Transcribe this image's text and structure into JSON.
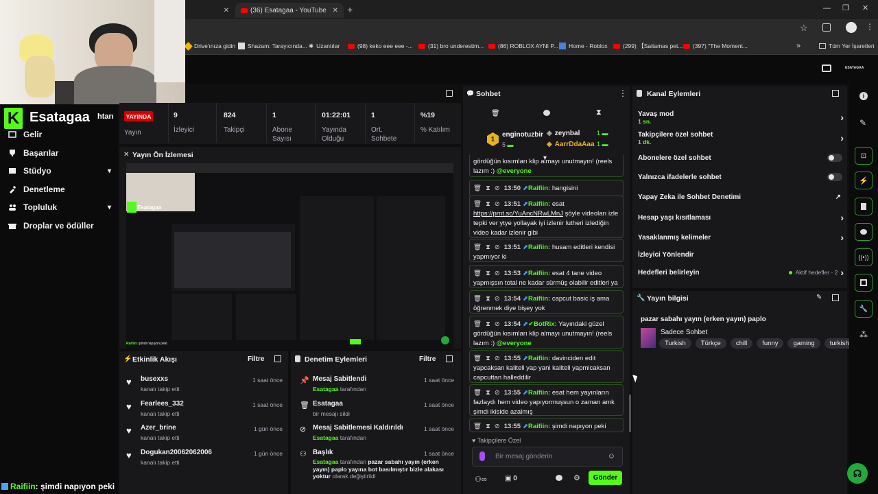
{
  "browser": {
    "tab_active": "(36) Esatagaa - YouTube",
    "bookmarks": [
      "Drive'ınıza gidin",
      "Shazam: Tarayıcında...",
      "Uzantılar",
      "(98) keko eee eee -...",
      "(31) bro underestim...",
      "(86) ROBLOX AYNI P...",
      "Home - Roblox",
      "(299) 【Saitamas pet...",
      "(397) \"The Moment...",
      "Tüm Yer İşaretleri"
    ],
    "more": "»"
  },
  "brand": {
    "logo_letter": "K",
    "channel": "Esatagaa",
    "cutoff": "htarı"
  },
  "header": {
    "user_short": "ESATAGAA"
  },
  "sidebar": {
    "items": [
      {
        "label": "Gelir",
        "icon": "money-icon"
      },
      {
        "label": "Başarılar",
        "icon": "trophy-icon"
      },
      {
        "label": "Stüdyo",
        "icon": "studio-icon",
        "expand": true
      },
      {
        "label": "Denetleme",
        "icon": "wrench-icon"
      },
      {
        "label": "Topluluk",
        "icon": "people-icon",
        "expand": true
      },
      {
        "label": "Droplar ve ödüller",
        "icon": "gift-icon"
      }
    ]
  },
  "stats": {
    "live_badge": "YAYINDA",
    "live_label": "Yayın",
    "items": [
      {
        "value": "9",
        "label": "İzleyici"
      },
      {
        "value": "824",
        "label": "Takipçi"
      },
      {
        "value": "1",
        "label": "Abone Sayısı"
      },
      {
        "value": "01:22:01",
        "label": "Yayında Olduğu"
      },
      {
        "value": "1",
        "label": "Ort. Sohbete"
      },
      {
        "value": "%19",
        "label": "% Katılım"
      }
    ]
  },
  "preview": {
    "title": "Yayın Ön İzlemesi",
    "mini_chat_user": "Raifiin",
    "mini_chat_text": ": şimdi napıyon peki"
  },
  "activity": {
    "title": "Etkinlik Akışı",
    "filter": "Filtre",
    "items": [
      {
        "name": "busexxs",
        "sub": "kanalı takip etti",
        "time": "1 saat önce"
      },
      {
        "name": "Fearlees_332",
        "sub": "kanalı takip etti",
        "time": "1 saat önce"
      },
      {
        "name": "Azer_brine",
        "sub": "kanalı takip etti",
        "time": "1 gün önce"
      },
      {
        "name": "Dogukan20062062006",
        "sub": "kanalı takip etti",
        "time": "1 gün önce"
      }
    ]
  },
  "moderation": {
    "title": "Denetim Eylemleri",
    "filter": "Filtre",
    "items": [
      {
        "title": "Mesaj Sabitlendi",
        "by": "Esatagaa",
        "suffix": " tarafından",
        "time": "1 saat önce",
        "icon": "pin-icon"
      },
      {
        "title": "Esatagaa",
        "by": "",
        "suffix": "bir mesajı sildi",
        "time": "1 saat önce",
        "icon": "trash-icon"
      },
      {
        "title": "Mesaj Sabitlemesi Kaldırıldı",
        "by": "Esatagaa",
        "suffix": " tarafından",
        "time": "1 saat önce",
        "icon": "unpin-icon"
      },
      {
        "title": "Başlık",
        "by": "Esatagaa",
        "suffix": " tarafından ",
        "bold": "pazar sabahı yayın (erken yayın) paplo yayına bot basılmıştır bizle alakası yoktur",
        "tail": " olarak değiştirildi",
        "time": "1 saat önce",
        "icon": "title-icon"
      }
    ]
  },
  "chat": {
    "title": "Sohbet",
    "leader": {
      "rank": "1",
      "name": "enginotuzbir",
      "count": "5"
    },
    "gifters": [
      {
        "name": "zeynbal",
        "count": "1"
      },
      {
        "name": "AarrDdaAaa",
        "count": "1"
      }
    ],
    "top_fragment": "gördüğün kısımları klip almayı unutmayın! (reels lazım :)",
    "top_mention": "@everyone",
    "messages": [
      {
        "time": "13:50",
        "user": "Raifiin",
        "text": "hangisini"
      },
      {
        "time": "13:51",
        "user": "Raifiin",
        "text": "esat",
        "link": "https://prnt.sc/YuAncNRwLMnJ",
        "rest": " şöyle videoları izle tepki ver ytye yollayak iyi izlenir lutheri izlediğin video kadar izlenir gibi"
      },
      {
        "time": "13:51",
        "user": "Raifiin",
        "text": "husam editleri kendisi yapmıyor ki"
      },
      {
        "time": "13:53",
        "user": "Raifiin",
        "text": "esat 4 tane video yapmışsın total ne kadar sürmüş olabilir editleri ya"
      },
      {
        "time": "13:54",
        "user": "Raifiin",
        "text": "capcut basic iş ama öğrenmek diye bişey yok"
      },
      {
        "time": "13:54",
        "user": "BotRix",
        "text": "Yayındaki güzel gördüğün kısımları klip almayı unutmayın! (reels lazım :)",
        "mention": "@everyone"
      },
      {
        "time": "13:55",
        "user": "Raifiin",
        "text": "davinciden edit yapcaksan kaliteli yap yani kaliteli yapmicaksan capcuttan halleddilir"
      },
      {
        "time": "13:55",
        "user": "Raifiin",
        "text": "esat hem yayınların fazlaydı hem video yapıyormuşsun o zaman amk şimdi ikiside azalmış"
      },
      {
        "time": "13:55",
        "user": "Raifiin",
        "text": "şimdi napıyon peki"
      }
    ],
    "follower_only": "Takipçilere Özel",
    "input_placeholder": "Bir mesaj gönderin",
    "count": "0",
    "send": "Gönder"
  },
  "channel_actions": {
    "title": "Kanal Eylemleri",
    "slow_mode": "Yavaş mod",
    "slow_mode_val": "1 sn.",
    "followers_only": "Takipçilere özel sohbet",
    "followers_only_val": "1 dk.",
    "subscribers_only": "Abonelere özel sohbet",
    "emote_only": "Yalnızca ifadelerle sohbet",
    "ai_moderation": "Yapay Zeka ile Sohbet Denetimi",
    "account_age": "Hesap yaşı kısıtlaması",
    "banned_words": "Yasaklanmış kelimeler",
    "redirect": "İzleyici Yönlendir",
    "goals": "Hedefleri belirleyin",
    "goals_status": "Aktif hedefler - 2"
  },
  "stream_info": {
    "title": "Yayın bilgisi",
    "stream_title": "pazar sabahı yayın (erken yayın) paplo",
    "category": "Sadece Sohbet",
    "tags": [
      "Turkish",
      "Türkçe",
      "chill",
      "funny",
      "gaming",
      "turkish"
    ]
  },
  "overlay_chat": {
    "user": "Raifiin",
    "text": ": şimdi napıyon peki"
  },
  "colors": {
    "accent": "#53fc18",
    "live": "#d60000",
    "panel": "#18181b",
    "bg": "#0f0f10"
  }
}
